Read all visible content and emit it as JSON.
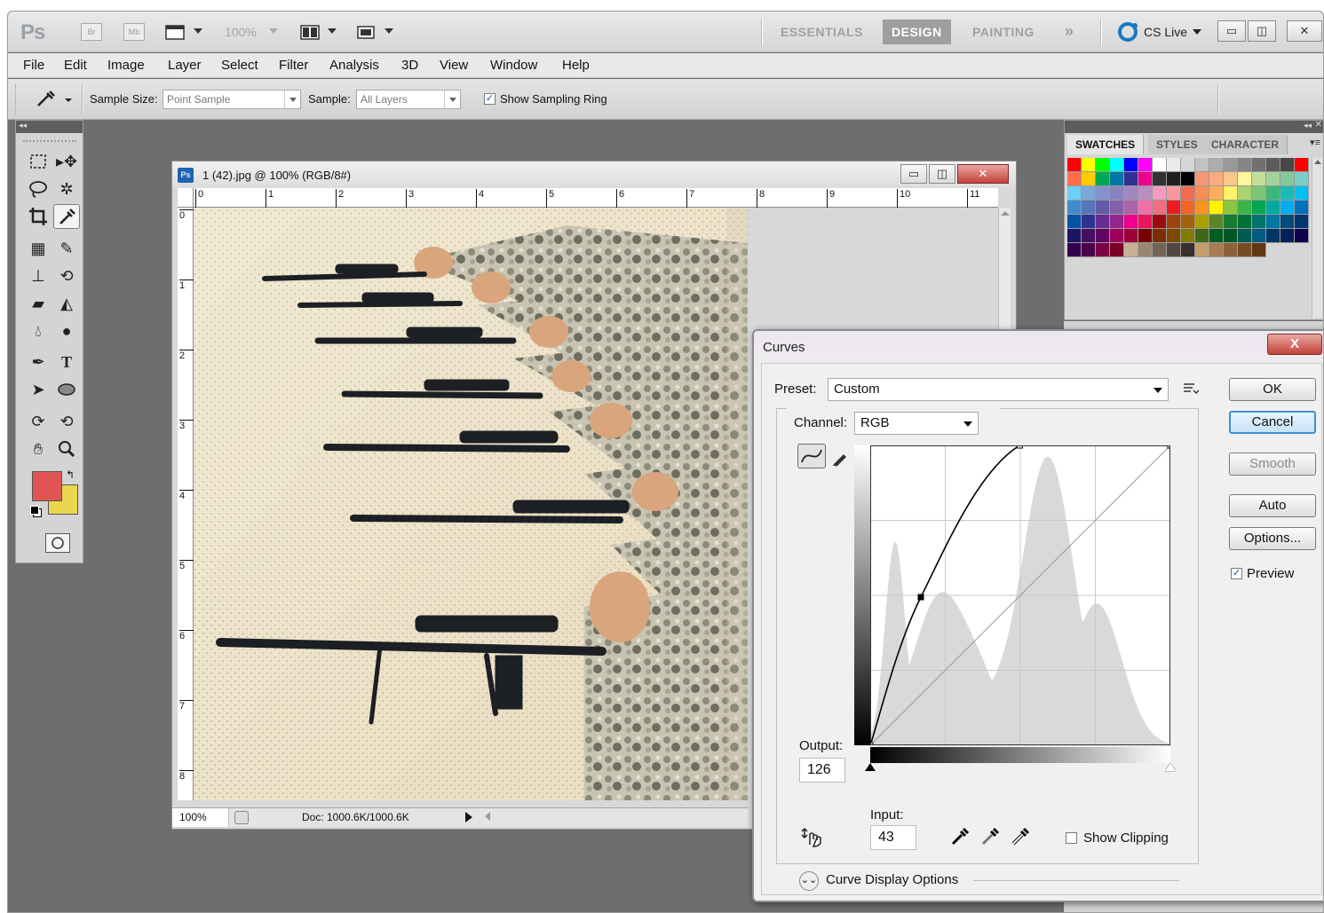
{
  "appbar": {
    "logo": "Ps",
    "bridge_label": "Br",
    "mini_bridge_label": "Mb",
    "zoom": "100%",
    "workspaces": [
      "ESSENTIALS",
      "DESIGN",
      "PAINTING"
    ],
    "active_workspace": "DESIGN",
    "more_label": "»",
    "cs_live": "CS Live"
  },
  "menu": [
    "File",
    "Edit",
    "Image",
    "Layer",
    "Select",
    "Filter",
    "Analysis",
    "3D",
    "View",
    "Window",
    "Help"
  ],
  "options": {
    "sample_size_label": "Sample Size:",
    "sample_size_value": "Point Sample",
    "sample_label": "Sample:",
    "sample_value": "All Layers",
    "show_ring_label": "Show Sampling Ring",
    "show_ring_checked": true
  },
  "tools": {
    "foreground_color": "#e05552",
    "background_color": "#ecd64e"
  },
  "document": {
    "title": "1 (42).jpg @ 100% (RGB/8#)",
    "ruler_top": [
      "0",
      "1",
      "2",
      "3",
      "4",
      "5",
      "6",
      "7",
      "8",
      "9",
      "10",
      "11"
    ],
    "ruler_left": [
      "0",
      "1",
      "2",
      "3",
      "4",
      "5",
      "6",
      "7",
      "8"
    ],
    "zoom": "100%",
    "doc_info": "Doc: 1000.6K/1000.6K"
  },
  "swatches": {
    "tabs": [
      "SWATCHES",
      "STYLES",
      "CHARACTER"
    ],
    "colors": [
      "#ff0000",
      "#ffff00",
      "#00ff00",
      "#00ffff",
      "#0000ff",
      "#ff00ff",
      "#ffffff",
      "#ebebeb",
      "#d6d6d6",
      "#c2c2c2",
      "#adadad",
      "#999999",
      "#858585",
      "#707070",
      "#5c5c5c",
      "#474747",
      "#ff0000",
      "#ff6f4e",
      "#ffcd00",
      "#00a651",
      "#0076a3",
      "#2e3192",
      "#ec008c",
      "#333333",
      "#1f1f1f",
      "#000000",
      "#f7977a",
      "#f9ad81",
      "#fdc68a",
      "#fff79a",
      "#c4df9b",
      "#a3d39c",
      "#82ca9d",
      "#7bcdc8",
      "#6ecff6",
      "#7ea7d8",
      "#8493ca",
      "#8882be",
      "#a187be",
      "#bc8dbf",
      "#f49ac2",
      "#f6989d",
      "#f26c4f",
      "#f68e55",
      "#fbaf5c",
      "#fff467",
      "#acd372",
      "#7cc576",
      "#3bb878",
      "#1abbb4",
      "#00bff3",
      "#438ccb",
      "#5574b9",
      "#605ca8",
      "#8560a8",
      "#a864a8",
      "#f06eaa",
      "#f26d7d",
      "#ed1c24",
      "#f26522",
      "#f7941d",
      "#fff200",
      "#8dc73f",
      "#39b54a",
      "#00a651",
      "#00a99d",
      "#00aeef",
      "#0072bc",
      "#0054a6",
      "#2e3192",
      "#662d91",
      "#92278f",
      "#ec008c",
      "#ed145b",
      "#9e0b0f",
      "#a0410d",
      "#a3620a",
      "#aba000",
      "#598527",
      "#197b30",
      "#007236",
      "#00746b",
      "#0076a3",
      "#004b80",
      "#003471",
      "#1b1464",
      "#440e62",
      "#630460",
      "#9e005d",
      "#9e0039",
      "#790000",
      "#7b2e00",
      "#7d4900",
      "#827b00",
      "#406618",
      "#005e20",
      "#005826",
      "#005952",
      "#005b7f",
      "#003663",
      "#002157",
      "#0d004c",
      "#32004b",
      "#4b0049",
      "#7b0046",
      "#7a0026",
      "#c7b299",
      "#998675",
      "#736357",
      "#534741",
      "#37302d",
      "#c69c6d",
      "#a67c52",
      "#8c6239",
      "#754c24",
      "#603913"
    ]
  },
  "curves": {
    "title": "Curves",
    "close_label": "X",
    "preset_label": "Preset:",
    "preset_value": "Custom",
    "channel_label": "Channel:",
    "channel_value": "RGB",
    "output_label": "Output:",
    "output_value": "126",
    "input_label": "Input:",
    "input_value": "43",
    "show_clipping_label": "Show Clipping",
    "show_clipping_checked": false,
    "curve_display_options_label": "Curve Display Options",
    "buttons": {
      "ok": "OK",
      "cancel": "Cancel",
      "smooth": "Smooth",
      "auto": "Auto",
      "options": "Options..."
    },
    "preview_label": "Preview",
    "preview_checked": true,
    "curve_points": [
      [
        0,
        0
      ],
      [
        43,
        126
      ],
      [
        127,
        255
      ],
      [
        255,
        255
      ]
    ]
  }
}
